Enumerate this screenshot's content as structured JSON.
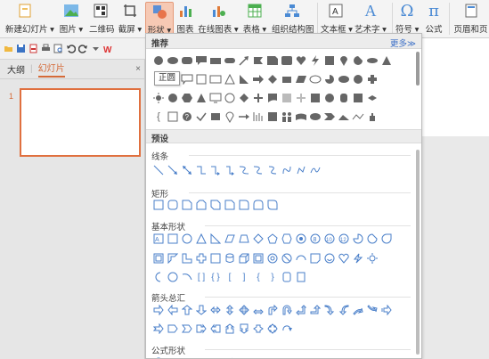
{
  "ribbon": {
    "buttons": [
      {
        "label": "新建幻灯片 ▾",
        "icon": "new-slide-icon"
      },
      {
        "label": "图片 ▾",
        "icon": "picture-icon"
      },
      {
        "label": "二维码",
        "icon": "qrcode-icon"
      },
      {
        "label": "截屏 ▾",
        "icon": "screenshot-icon"
      },
      {
        "label": "形状 ▾",
        "icon": "shapes-icon"
      },
      {
        "label": "图表",
        "icon": "chart-icon"
      },
      {
        "label": "在线图表 ▾",
        "icon": "online-chart-icon"
      },
      {
        "label": "表格 ▾",
        "icon": "table-icon"
      },
      {
        "label": "组织结构图",
        "icon": "org-chart-icon"
      },
      {
        "label": "文本框 ▾",
        "icon": "textbox-icon"
      },
      {
        "label": "艺术字 ▾",
        "icon": "wordart-icon"
      },
      {
        "label": "符号 ▾",
        "icon": "omega-icon"
      },
      {
        "label": "公式",
        "icon": "pi-icon"
      },
      {
        "label": "页眉和页",
        "icon": "header-footer-icon"
      }
    ],
    "accent": "#f6c9b4"
  },
  "left_pane": {
    "tab_outline": "大纲",
    "tab_slides": "幻灯片",
    "close": "×",
    "slide_number": "1"
  },
  "dropdown": {
    "title": "推荐",
    "more": "更多≫",
    "preset": "预设",
    "categories": {
      "lines": "线条",
      "rect": "矩形",
      "basic": "基本形状",
      "arrows": "箭头总汇",
      "formula": "公式形状"
    }
  },
  "tooltip": "正圆"
}
